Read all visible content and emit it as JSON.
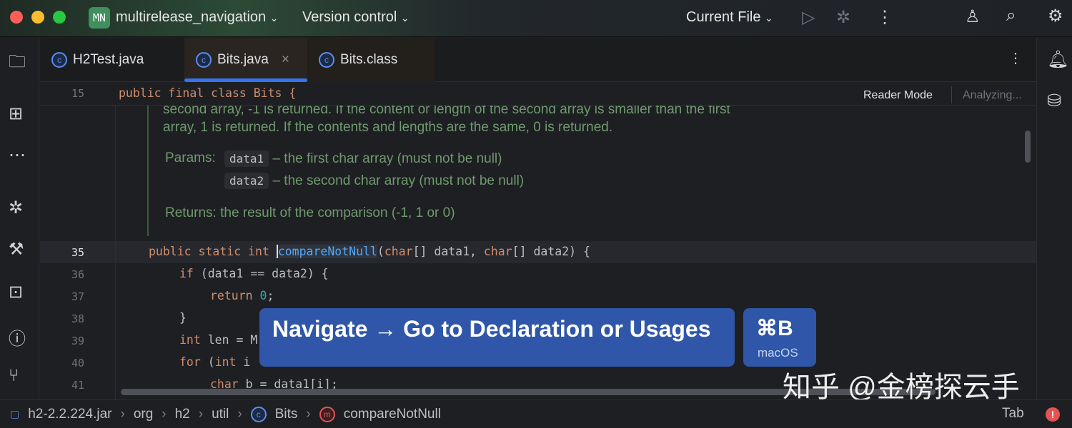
{
  "titlebar": {
    "project_badge": "MN",
    "project": "multirelease_navigation",
    "vcs": "Version control",
    "run_config": "Current File"
  },
  "tabs": [
    {
      "label": "H2Test.java"
    },
    {
      "label": "Bits.java",
      "active": true
    },
    {
      "label": "Bits.class"
    }
  ],
  "editor": {
    "reader_mode": "Reader Mode",
    "analyzing": "Analyzing...",
    "sticky_line_no": "15",
    "sticky": "public final class Bits {",
    "doc_line1": "second array, -1 is returned. If the content or length of the second array is smaller than the first",
    "doc_line2": "array, 1 is returned. If the contents and lengths are the same, 0 is returned.",
    "params_label": "Params:",
    "param1_name": "data1",
    "param1_desc": "– the first char array (must not be null)",
    "param2_name": "data2",
    "param2_desc": "– the second char array (must not be null)",
    "returns_label": "Returns:",
    "returns_desc": "the result of the comparison (-1, 1 or 0)",
    "line_numbers": [
      "35",
      "36",
      "37",
      "38",
      "39",
      "40",
      "41"
    ]
  },
  "popup": {
    "action": "Navigate → Go to Declaration or Usages",
    "shortcut": "⌘B",
    "os": "macOS"
  },
  "watermark": "知乎 @金榜探云手",
  "statusbar": {
    "crumbs": [
      "h2-2.2.224.jar",
      "org",
      "h2",
      "util",
      "Bits",
      "compareNotNull"
    ],
    "indent": "Tab"
  },
  "colors": {
    "accent": "#3574f0",
    "popup": "#2f56a8",
    "error": "#e55353"
  }
}
